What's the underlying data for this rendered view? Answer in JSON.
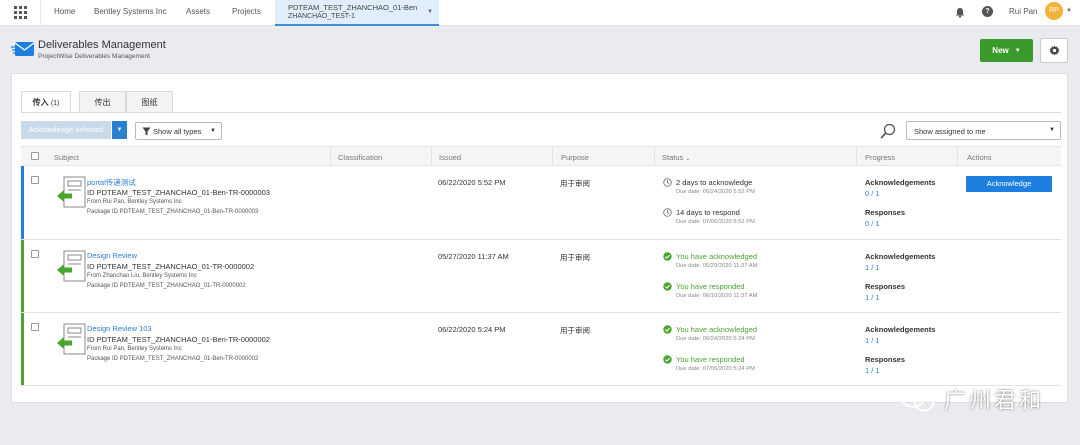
{
  "topnav": {
    "items": [
      "Home",
      "Bentley Systems Inc",
      "Assets",
      "Projects"
    ],
    "active_line1": "PDTEAM_TEST_ZHANCHAO_01-Ben",
    "active_line2": "ZHANCHAO_TEST-1",
    "user_name": "Rui Pan",
    "avatar_initials": "RP"
  },
  "header": {
    "title": "Deliverables Management",
    "subtitle": "ProjectWise Deliverables Management",
    "new_label": "New"
  },
  "tabs": [
    {
      "label": "传入",
      "count": "(1)"
    },
    {
      "label": "传出"
    },
    {
      "label": "图纸"
    }
  ],
  "toolbar": {
    "acknowledge_selected": "Acknowledge selected",
    "types_filter": "Show all types",
    "assigned_filter": "Show assigned to me"
  },
  "table": {
    "columns": [
      "Subject",
      "Classification",
      "Issued",
      "Purpose",
      "Status",
      "Progress",
      "Actions"
    ],
    "rows": [
      {
        "subject": "portal传递测试",
        "id": "ID PDTEAM_TEST_ZHANCHAO_01-Ben-TR-0000003",
        "from": "From Rui Pan, Bentley Systems Inc",
        "package": "Package ID PDTEAM_TEST_ZHANCHAO_01-Ben-TR-0000003",
        "issued": "06/22/2020 5:52 PM",
        "purpose": "用于审阅",
        "status1": "2 days to acknowledge",
        "due1": "Due date: 06/24/2020 5:52 PM",
        "status2": "14 days to respond",
        "due2": "Due date: 07/06/2020 5:52 PM",
        "ack_label": "Acknowledgements",
        "ack_value": "0 / 1",
        "resp_label": "Responses",
        "resp_value": "0 / 1",
        "action": "Acknowledge"
      },
      {
        "subject": "Design Review",
        "id": "ID PDTEAM_TEST_ZHANCHAO_01-TR-0000002",
        "from": "From Zhanchao Liu, Bentley Systems Inc",
        "package": "Package ID PDTEAM_TEST_ZHANCHAO_01-TR-0000002",
        "issued": "05/27/2020 11:37 AM",
        "purpose": "用于审阅",
        "status1": "You have acknowledged",
        "due1": "Due date: 05/29/2020 11:37 AM",
        "status2": "You have responded",
        "due2": "Due date: 06/10/2020 11:37 AM",
        "ack_label": "Acknowledgements",
        "ack_value": "1 / 1",
        "resp_label": "Responses",
        "resp_value": "1 / 1"
      },
      {
        "subject": "Design Review 103",
        "id": "ID PDTEAM_TEST_ZHANCHAO_01-Ben-TR-0000002",
        "from": "From Rui Pan, Bentley Systems Inc",
        "package": "Package ID PDTEAM_TEST_ZHANCHAO_01-Ben-TR-0000002",
        "issued": "06/22/2020 5:24 PM",
        "purpose": "用于审阅",
        "status1": "You have acknowledged",
        "due1": "Due date: 06/24/2020 5:24 PM",
        "status2": "You have responded",
        "due2": "Due date: 07/06/2020 5:24 PM",
        "ack_label": "Acknowledgements",
        "ack_value": "1 / 1",
        "resp_label": "Responses",
        "resp_value": "1 / 1"
      }
    ]
  },
  "watermark": {
    "text": "广州君和"
  },
  "colors": {
    "accent": "#2b7fd1",
    "pending_bar": "#1e7fe0",
    "done_bar": "#4aa52f",
    "new_button": "#3a9a2b",
    "done_text": "#4aa52f"
  }
}
